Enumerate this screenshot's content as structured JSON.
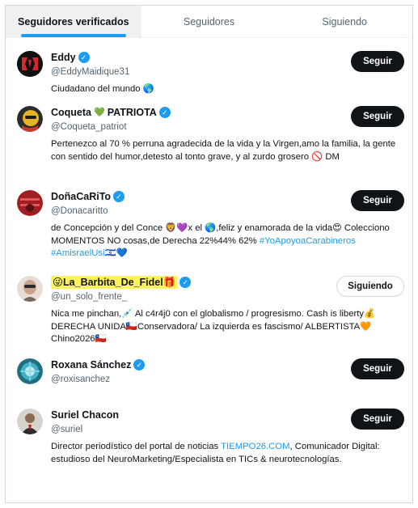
{
  "tabs": [
    {
      "label": "Seguidores verificados",
      "active": true
    },
    {
      "label": "Seguidores",
      "active": false
    },
    {
      "label": "Siguiendo",
      "active": false
    }
  ],
  "users": [
    {
      "name": "Eddy",
      "handle": "@EddyMaidique31",
      "bio": "Ciudadano del mundo 🌎",
      "button": "Seguir",
      "avatar_color": "#1a1a1a"
    },
    {
      "name_prefix": "Coqueta ",
      "name_emoji": "💚",
      "name_suffix": "PATRIOTA",
      "handle": "@Coqueta_patriot",
      "bio": "Pertenezco al 70 % perruna agradecida de la vida y la Virgen,amo la familia, la gente con sentido del humor,detesto al tonto grave, y al zurdo grosero 🚫 DM",
      "button": "Seguir",
      "avatar_color": "#c9a227"
    },
    {
      "name": "DoñaCaRiTo",
      "handle": "@Donacaritto",
      "bio": "de Concepción y del Conce 🦁💜x el 🌎,feliz y enamorada de la vida😍 Colecciono MOMENTOS NO cosas,de Derecha 22%44% 62%",
      "hashtags": "#YoApoyoaCarabineros #AmisraelUsi🇮🇱💙",
      "button": "Seguir",
      "avatar_color": "#b3262a"
    },
    {
      "name": "😜La_Barbita_De_Fidel🎁",
      "handle": "@un_solo_frente_",
      "bio": "Nica me pinchan,💉 Al c4r4j0 con el globalismo / progresismo. Cash is liberty💰DERECHA UNIDA🇨🇱Conservadora/ La izquierda es fascismo/ ALBERTISTA🧡Chino2026🇨🇱",
      "button": "Siguiendo",
      "avatar_color": "#d9c6b8"
    },
    {
      "name": "Roxana Sánchez",
      "handle": "@roxisanchez",
      "bio": "",
      "button": "Seguir",
      "avatar_color": "#3aa7b8"
    },
    {
      "name": "Suriel Chacon",
      "handle": "@suriel",
      "bio_prefix": "Director periodístico del portal de noticias ",
      "bio_link": "TIEMPO26.COM",
      "bio_suffix": ", Comunicador Digital: estudioso del NeuroMarketing/Especialista en TICs & neurotecnologías.",
      "button": "Seguir",
      "avatar_color": "#8a6f5c"
    }
  ],
  "colors": {
    "accent": "#1d9bf0",
    "follow_button": "#0f1419",
    "highlight": "#fff25e"
  },
  "icons": {
    "verified": "verified-badge-icon"
  }
}
